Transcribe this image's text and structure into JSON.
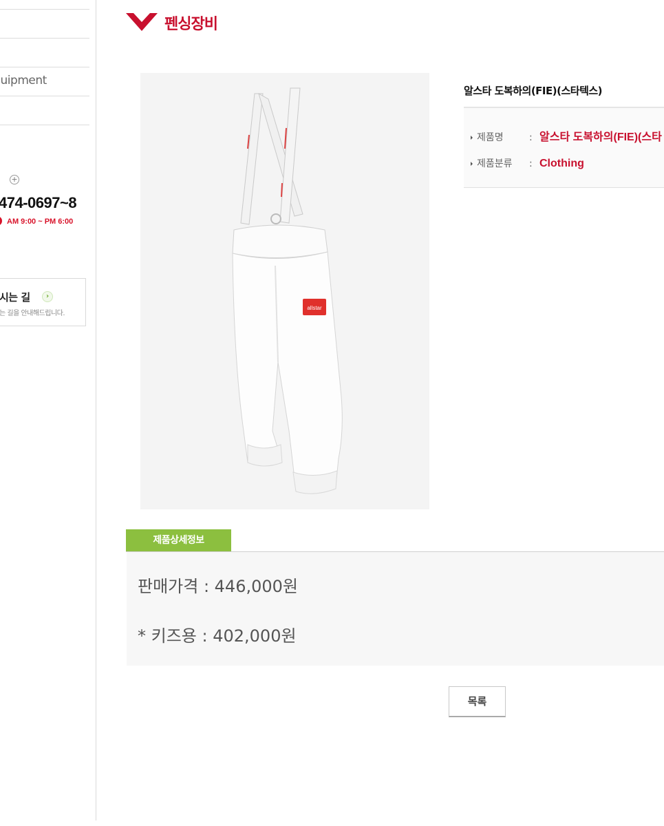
{
  "sidebar": {
    "menu_label": "Equipment",
    "phone": "474-0697~8",
    "hours": "AM 9:00 ~ PM 6:00",
    "map_title": "시는 길",
    "map_desc": "는 길을 안내해드립니다."
  },
  "header": {
    "title": "펜싱장비",
    "brand_color": "#c8102e"
  },
  "product": {
    "heading": "알스타 도복하의(FIE)(스타텍스)",
    "fields": [
      {
        "label": "제품명",
        "colon": ":",
        "value": "알스타 도복하의(FIE)(스타"
      },
      {
        "label": "제품분류",
        "colon": ":",
        "value": "Clothing"
      }
    ],
    "image_icon": "fencing-pants-image"
  },
  "detail": {
    "tab_label": "제품상세정보",
    "tab_color": "#8cbf3f",
    "price_line": "판매가격 : 446,000원",
    "kids_line": "* 키즈용 : 402,000원"
  },
  "actions": {
    "list_button": "목록"
  }
}
